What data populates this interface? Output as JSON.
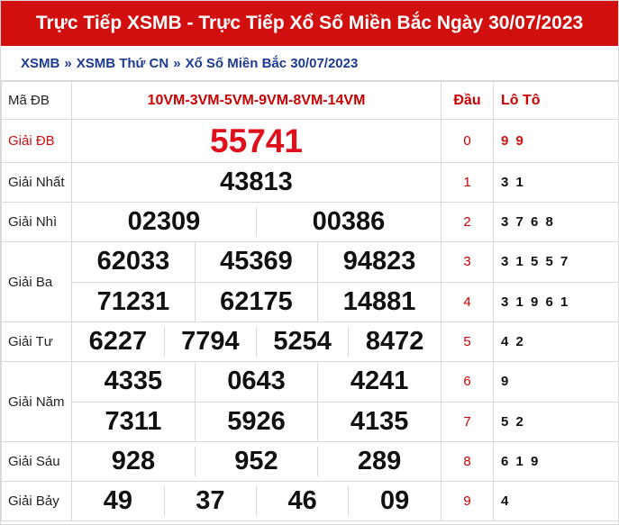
{
  "title": "Trực Tiếp XSMB - Trực Tiếp Xổ Số Miền Bắc Ngày 30/07/2023",
  "breadcrumb": {
    "items": [
      "XSMB",
      "XSMB Thứ CN",
      "Xổ Số Miền Bắc 30/07/2023"
    ],
    "separator": "»"
  },
  "header": {
    "ma_db_label": "Mã ĐB",
    "ma_db_code": "10VM-3VM-5VM-9VM-8VM-14VM",
    "dau_label": "Đầu",
    "loto_label": "Lô Tô"
  },
  "prizes": {
    "db": {
      "label": "Giải ĐB",
      "numbers": [
        "55741"
      ]
    },
    "nhat": {
      "label": "Giải Nhất",
      "numbers": [
        "43813"
      ]
    },
    "nhi": {
      "label": "Giải Nhì",
      "numbers": [
        "02309",
        "00386"
      ]
    },
    "ba": {
      "label": "Giải Ba",
      "numbers": [
        "62033",
        "45369",
        "94823",
        "71231",
        "62175",
        "14881"
      ]
    },
    "tu": {
      "label": "Giải Tư",
      "numbers": [
        "6227",
        "7794",
        "5254",
        "8472"
      ]
    },
    "nam": {
      "label": "Giải Năm",
      "numbers": [
        "4335",
        "0643",
        "4241",
        "7311",
        "5926",
        "4135"
      ]
    },
    "sau": {
      "label": "Giải Sáu",
      "numbers": [
        "928",
        "952",
        "289"
      ]
    },
    "bay": {
      "label": "Giải Bảy",
      "numbers": [
        "49",
        "37",
        "46",
        "09"
      ]
    }
  },
  "loto": [
    {
      "dau": "0",
      "values": "9 9"
    },
    {
      "dau": "1",
      "values": "3 1"
    },
    {
      "dau": "2",
      "values": "3 7 6 8"
    },
    {
      "dau": "3",
      "values": "3 1 5 5 7"
    },
    {
      "dau": "4",
      "values": "3 1 9 6 1"
    },
    {
      "dau": "5",
      "values": "4 2"
    },
    {
      "dau": "6",
      "values": "9"
    },
    {
      "dau": "7",
      "values": "5 2"
    },
    {
      "dau": "8",
      "values": "6 1 9"
    },
    {
      "dau": "9",
      "values": "4"
    }
  ],
  "colors": {
    "header_bg": "#d20f0f",
    "breadcrumb": "#1f3a93",
    "special_prize": "#e0101a",
    "border": "#d9d9d9"
  }
}
